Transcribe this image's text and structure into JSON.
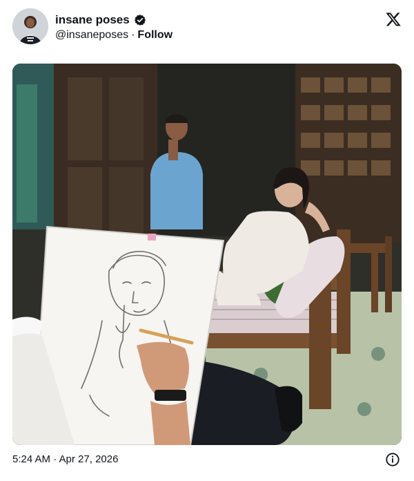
{
  "tweet": {
    "author": {
      "display_name": "insane poses",
      "handle": "@insaneposes",
      "verified": true,
      "avatar_icon": "avatar-portrait"
    },
    "separator": "·",
    "follow_label": "Follow",
    "platform_icon": "x-logo-icon",
    "media": {
      "kind": "photo"
    },
    "timestamp": "5:24 AM · Apr 27, 2026",
    "info_icon": "info-icon"
  },
  "colors": {
    "text_primary": "#0f1419",
    "verified_badge": "#0f1419",
    "background": "#ffffff"
  }
}
